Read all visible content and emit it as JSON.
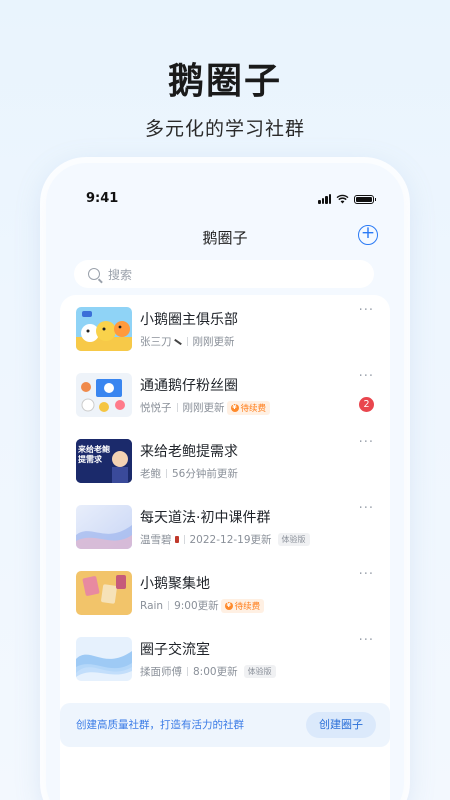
{
  "hero": {
    "title": "鹅圈子",
    "subtitle": "多元化的学习社群"
  },
  "statusbar": {
    "time": "9:41"
  },
  "navbar": {
    "title": "鹅圈子",
    "add_icon": "plus-circle-icon"
  },
  "search": {
    "placeholder": "搜索"
  },
  "groups": [
    {
      "name": "小鹅圈主俱乐部",
      "author": "张三刀",
      "updated": "刚刚更新",
      "tag": "",
      "unread": ""
    },
    {
      "name": "通通鹅仔粉丝圈",
      "author": "悦悦子",
      "updated": "刚刚更新",
      "tag": "待续费",
      "unread": "2"
    },
    {
      "name": "来给老鲍提需求",
      "author": "老鲍",
      "updated": "56分钟前更新",
      "tag": "",
      "unread": ""
    },
    {
      "name": "每天道法·初中课件群",
      "author": "温雪碧",
      "updated": "2022-12-19更新",
      "tag": "体验版",
      "unread": ""
    },
    {
      "name": "小鹅聚集地",
      "author": "Rain",
      "updated": "9:00更新",
      "tag": "待续费",
      "unread": ""
    },
    {
      "name": "圈子交流室",
      "author": "揉面师傅",
      "updated": "8:00更新",
      "tag": "体验版",
      "unread": ""
    }
  ],
  "thumb_texts": {
    "third": "来给老鲍提需求"
  },
  "more_label": "···",
  "create": {
    "prompt": "创建高质量社群，打造有活力的社群",
    "button": "创建圈子"
  },
  "colors": {
    "accent": "#2a7af5",
    "badge": "#e9464e",
    "tag_orange": "#ff7d1a"
  }
}
